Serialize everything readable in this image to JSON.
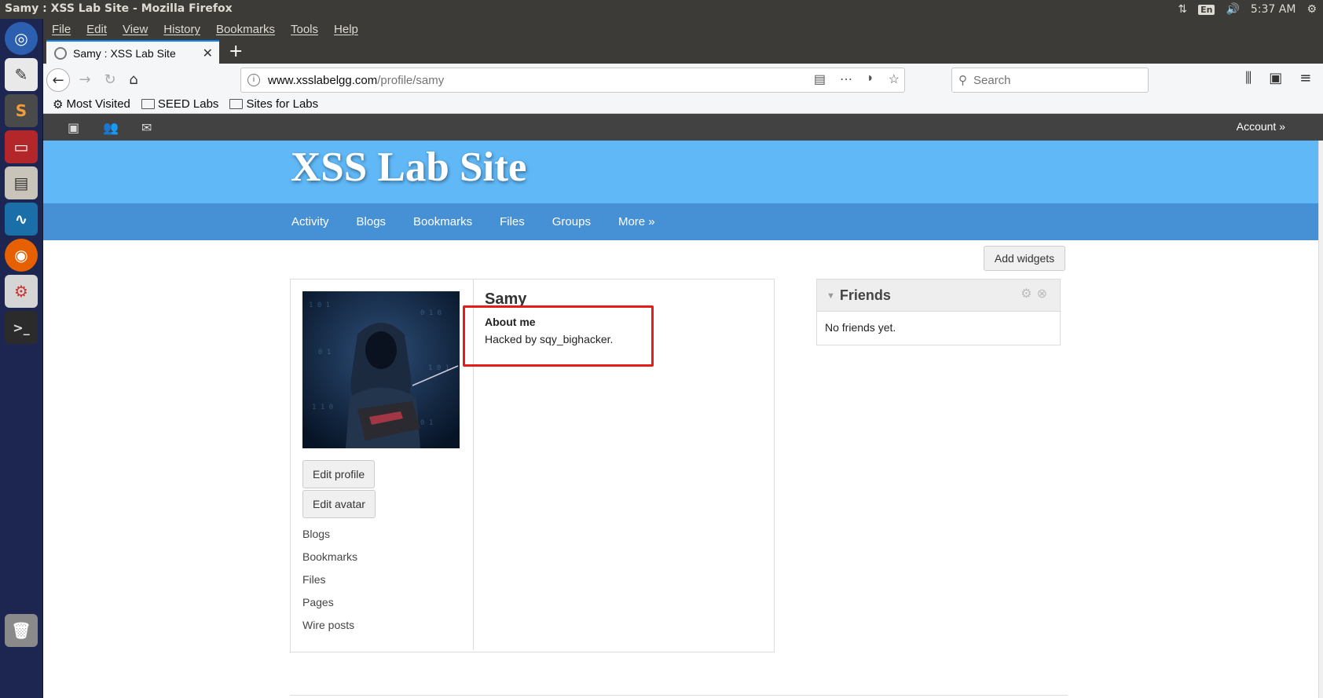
{
  "os": {
    "window_title": "Samy : XSS Lab Site - Mozilla Firefox",
    "tray": {
      "lang": "En",
      "time": "5:37 AM"
    }
  },
  "browser": {
    "menu": [
      "File",
      "Edit",
      "View",
      "History",
      "Bookmarks",
      "Tools",
      "Help"
    ],
    "tab_title": "Samy : XSS Lab Site",
    "url_host": "www.xsslabelgg.com",
    "url_path": "/profile/samy",
    "search_placeholder": "Search",
    "bookmarks": [
      "Most Visited",
      "SEED Labs",
      "Sites for Labs"
    ]
  },
  "site": {
    "account_label": "Account »",
    "name": "XSS Lab Site",
    "menu": [
      "Activity",
      "Blogs",
      "Bookmarks",
      "Files",
      "Groups",
      "More »"
    ],
    "add_widgets": "Add widgets"
  },
  "profile": {
    "name": "Samy",
    "edit_profile": "Edit profile",
    "edit_avatar": "Edit avatar",
    "links": [
      "Blogs",
      "Bookmarks",
      "Files",
      "Pages",
      "Wire posts"
    ],
    "about_heading": "About me",
    "about_text": "Hacked by sqy_bighacker."
  },
  "friends_widget": {
    "title": "Friends",
    "empty_text": "No friends yet."
  },
  "colors": {
    "header_blue": "#60b8f7",
    "menu_blue": "#4690d6",
    "topbar_gray": "#424242",
    "highlight_red": "#e51c1c"
  }
}
